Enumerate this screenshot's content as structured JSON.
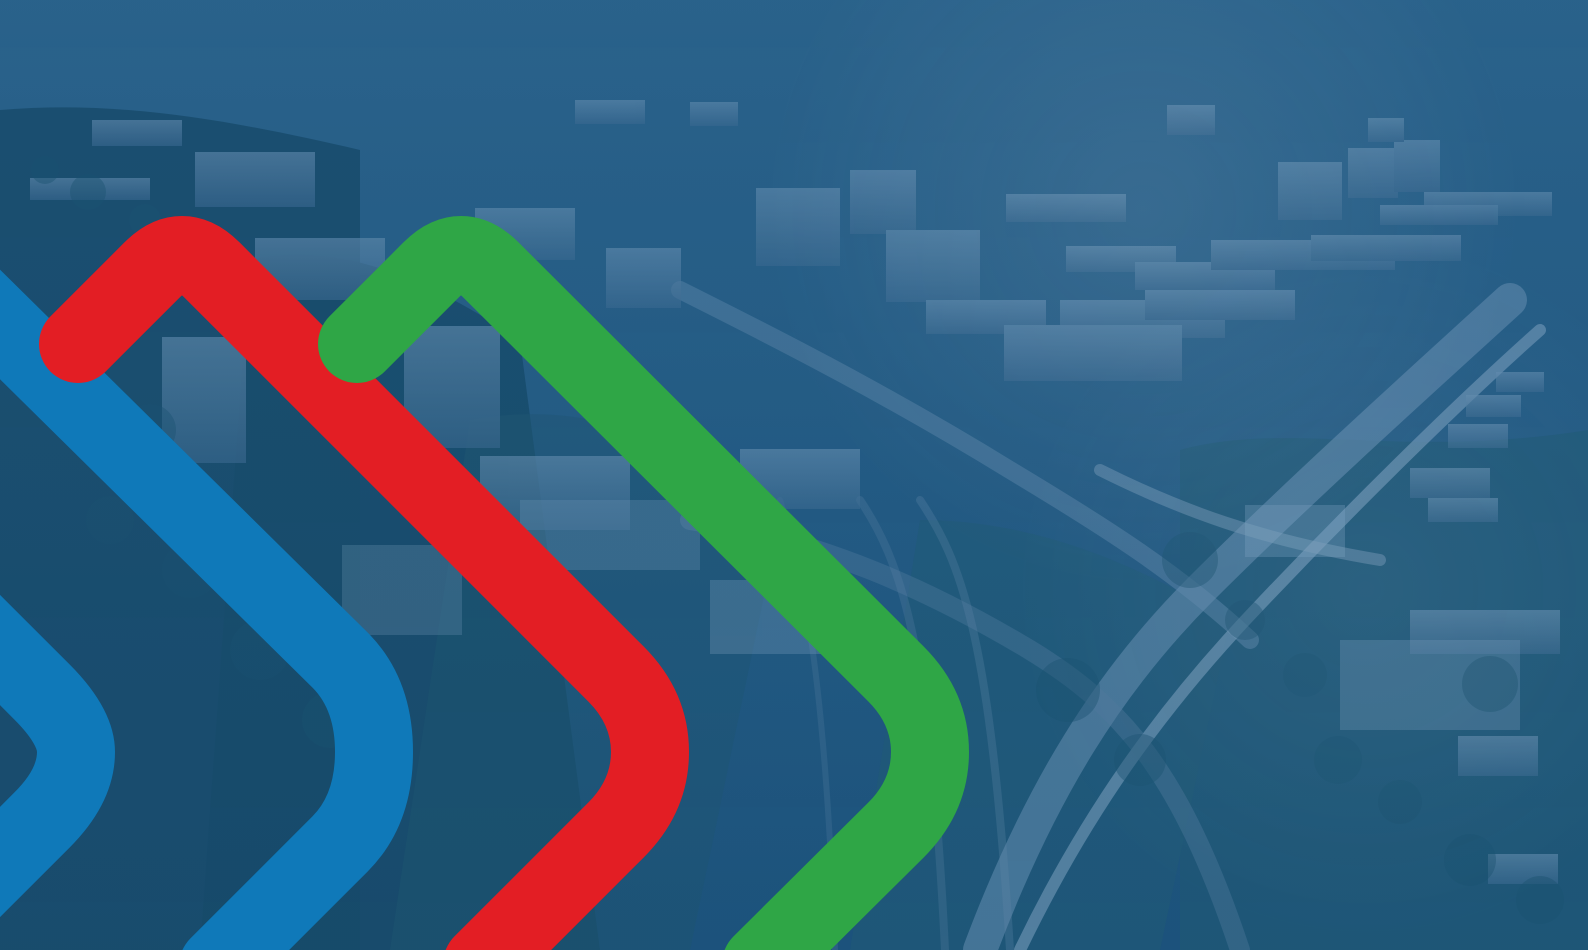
{
  "colors": {
    "base_blue": "#1d4f7d",
    "photo_blue_light": "#3a6f98",
    "photo_blue_mid": "#2d638f",
    "photo_blue_dark": "#184a74",
    "foliage_dark": "#1d5674",
    "road_light": "#5f87a9",
    "chevron_blue": "#0f79b9",
    "chevron_red": "#e31e24",
    "chevron_green": "#2fa646"
  },
  "icons": {
    "hero_photo": "aerial-city-photo",
    "brand_mark": "chevron-stripes"
  }
}
